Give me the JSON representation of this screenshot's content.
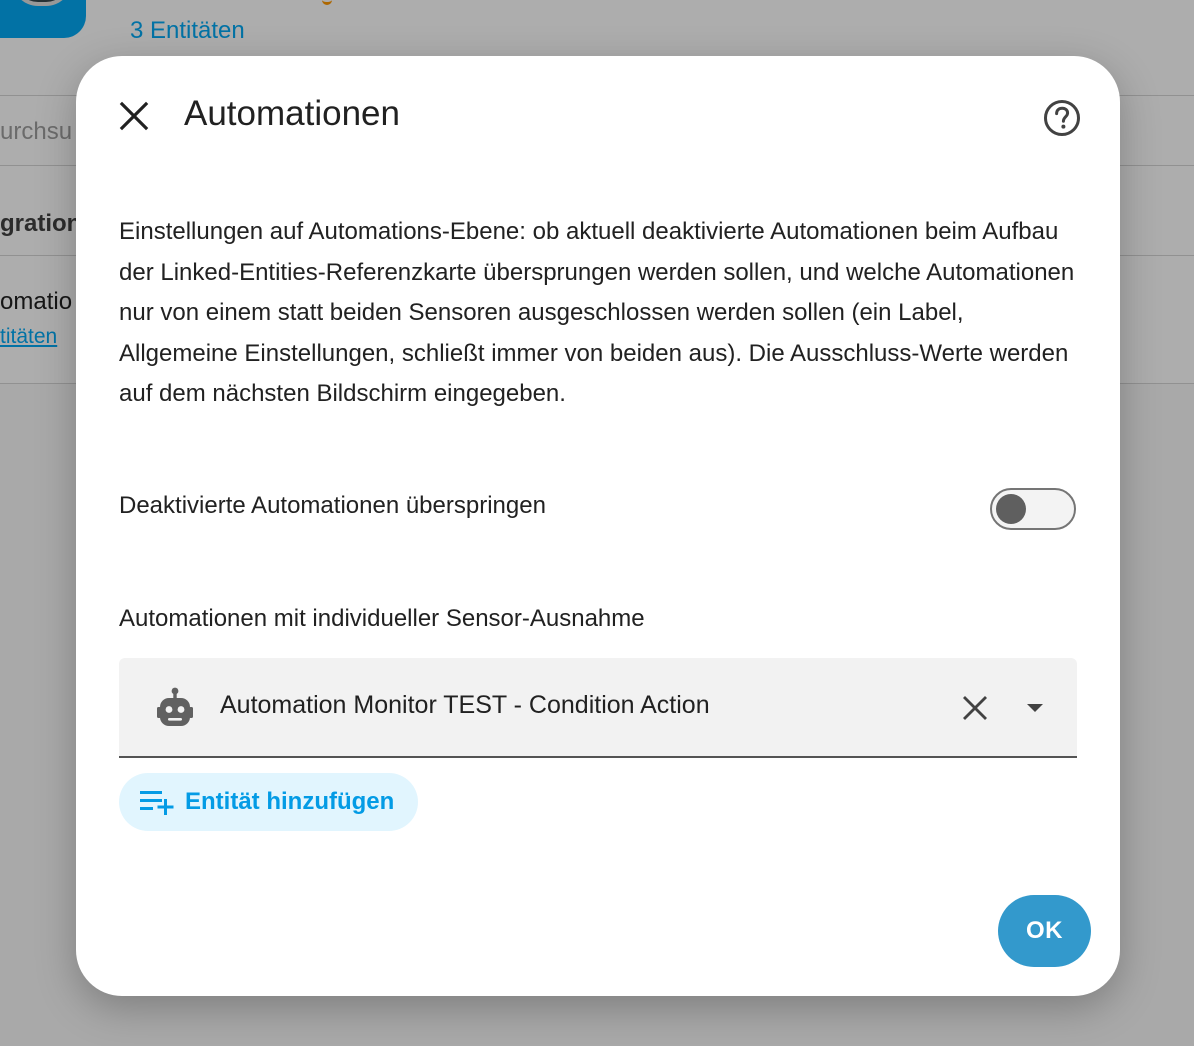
{
  "background": {
    "entities_link": "3 Entitäten",
    "search_placeholder": "urchsu",
    "section_heading": "gration",
    "item_title": "omatio",
    "item_entities": "titäten"
  },
  "dialog": {
    "title": "Automationen",
    "description": "Einstellungen auf Automations-Ebene: ob aktuell deaktivierte Automationen beim Aufbau der Linked-Entities-Referenzkarte übersprungen werden sollen, und welche Automationen nur von einem statt beiden Sensoren ausgeschlossen werden sollen (ein Label, Allgemeine Einstellungen, schließt immer von beiden aus). Die Ausschluss-Werte werden auf dem nächsten Bildschirm eingegeben.",
    "toggle": {
      "label": "Deaktivierte Automationen überspringen",
      "checked": false
    },
    "exceptions": {
      "label": "Automationen mit individueller Sensor-Ausnahme",
      "selected_entity": "Automation Monitor TEST - Condition Action",
      "entity_icon": "robot-icon"
    },
    "add_entity_label": "Entität hinzufügen",
    "ok_label": "OK"
  },
  "colors": {
    "primary": "#03a9f4",
    "ok_button": "#3399cc",
    "add_button_bg": "#e1f5fe"
  }
}
